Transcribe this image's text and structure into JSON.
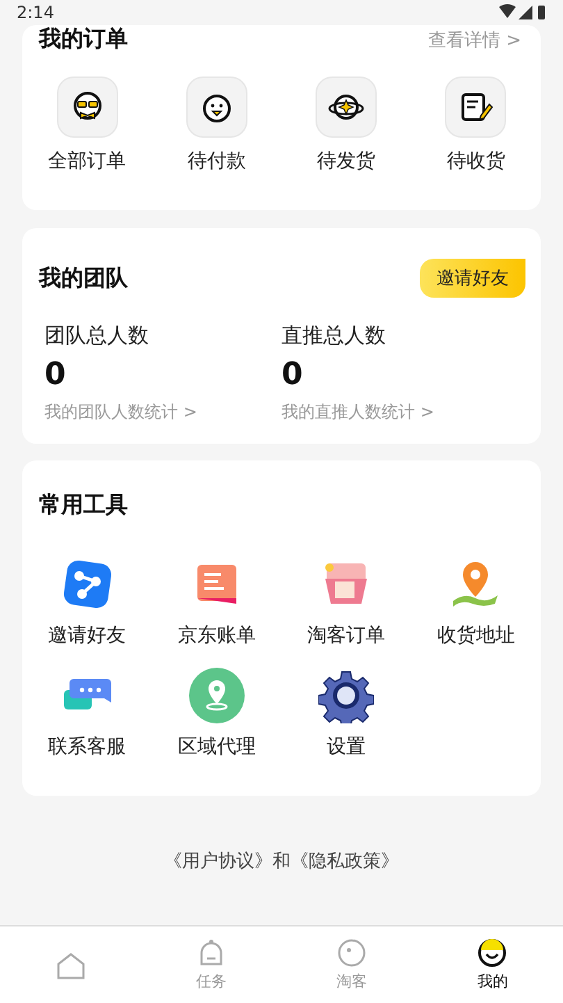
{
  "status_bar": {
    "time": "2:14"
  },
  "orders": {
    "title": "我的订单",
    "more": "查看详情 >",
    "items": [
      {
        "label": "全部订单",
        "kind": "glasses"
      },
      {
        "label": "待付款",
        "kind": "chick"
      },
      {
        "label": "待发货",
        "kind": "planet"
      },
      {
        "label": "待收货",
        "kind": "note"
      }
    ]
  },
  "team": {
    "title": "我的团队",
    "invite": "邀请好友",
    "stats": [
      {
        "label": "团队总人数",
        "value": "0",
        "link": "我的团队人数统计 >"
      },
      {
        "label": "直推总人数",
        "value": "0",
        "link": "我的直推人数统计 >"
      }
    ]
  },
  "tools": {
    "title": "常用工具",
    "items": [
      {
        "label": "邀请好友",
        "kind": "share"
      },
      {
        "label": "京东账单",
        "kind": "bill"
      },
      {
        "label": "淘客订单",
        "kind": "basket"
      },
      {
        "label": "收货地址",
        "kind": "pin"
      },
      {
        "label": "联系客服",
        "kind": "chat"
      },
      {
        "label": "区域代理",
        "kind": "region"
      },
      {
        "label": "设置",
        "kind": "gear"
      }
    ]
  },
  "footer": "《用户协议》和《隐私政策》",
  "tabs": [
    {
      "kind": "home",
      "selected": false
    },
    {
      "label": "任务",
      "kind": "task",
      "selected": false
    },
    {
      "label": "淘客",
      "kind": "circle",
      "selected": false
    },
    {
      "label": "我的",
      "kind": "me",
      "selected": true
    }
  ]
}
